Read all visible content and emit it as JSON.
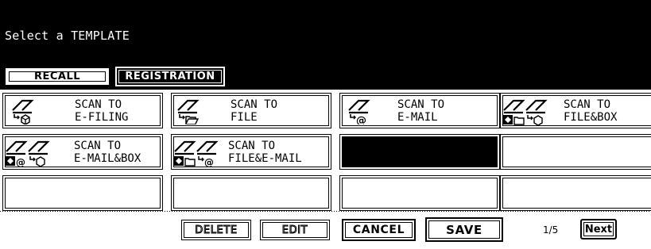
{
  "header": {
    "prompt": "Select a TEMPLATE"
  },
  "tabs": {
    "recall": "RECALL",
    "registration": "REGISTRATION"
  },
  "templates": [
    {
      "line1": "SCAN TO",
      "line2": "E-FILING",
      "icon": "scan-to-efiling-icon"
    },
    {
      "line1": "SCAN TO",
      "line2": "FILE",
      "icon": "scan-to-file-icon"
    },
    {
      "line1": "SCAN TO",
      "line2": "E-MAIL",
      "icon": "scan-to-email-icon"
    },
    {
      "line1": "SCAN TO",
      "line2": "FILE&BOX",
      "icon": "scan-to-file-and-box-icon"
    },
    {
      "line1": "SCAN TO",
      "line2": "E-MAIL&BOX",
      "icon": "scan-to-email-and-box-icon"
    },
    {
      "line1": "SCAN TO",
      "line2": "FILE&E-MAIL",
      "icon": "scan-to-file-and-email-icon"
    }
  ],
  "footer": {
    "delete": "DELETE",
    "edit": "EDIT",
    "cancel": "CANCEL",
    "save": "SAVE",
    "page_indicator": "1/5",
    "next": "Next"
  }
}
